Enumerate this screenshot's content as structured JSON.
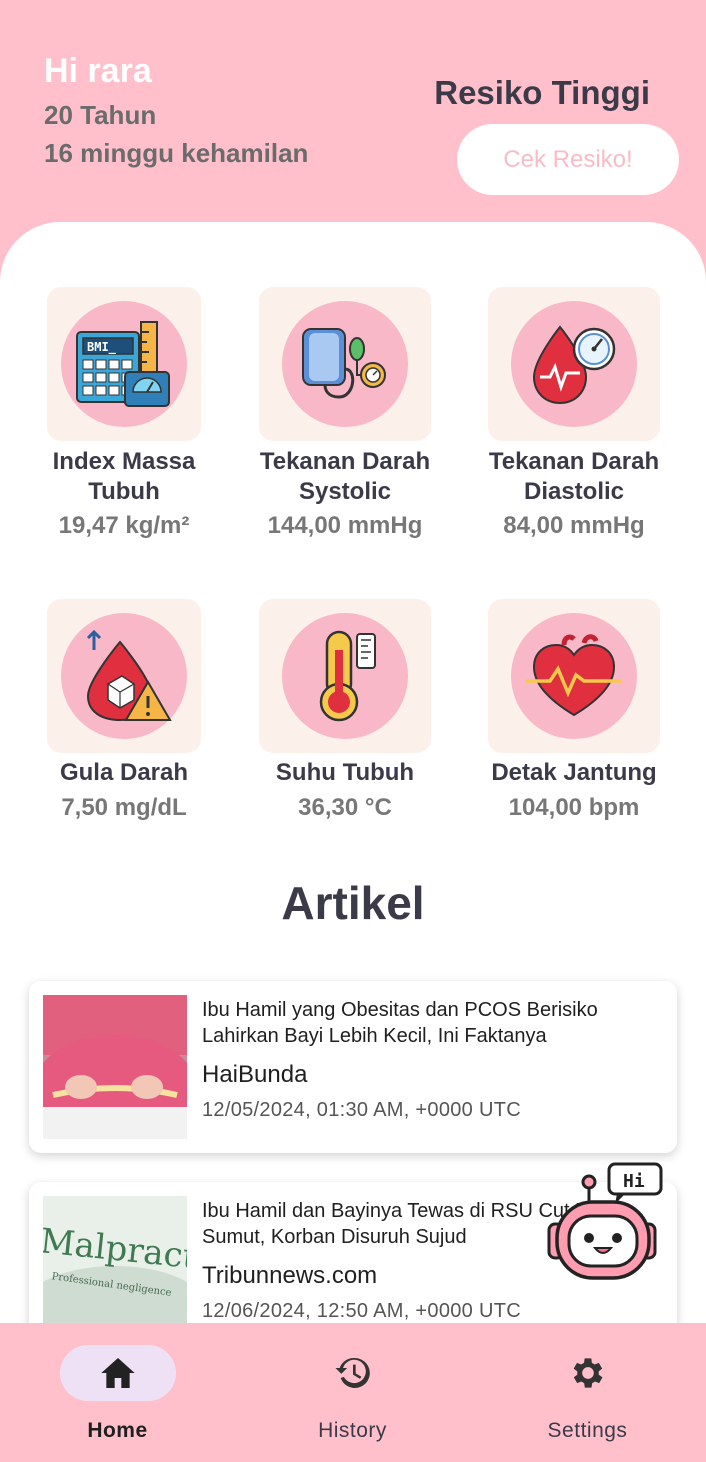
{
  "header": {
    "greeting": "Hi rara",
    "age": "20 Tahun",
    "pregnancy": "16 minggu kehamilan",
    "risk_status": "Resiko Tinggi",
    "check_button": "Cek Resiko!"
  },
  "metrics": [
    {
      "label": "Index Massa Tubuh",
      "value": "19,47 kg/m²",
      "icon": "bmi-icon"
    },
    {
      "label": "Tekanan Darah Systolic",
      "value": "144,00 mmHg",
      "icon": "blood-pressure-icon"
    },
    {
      "label": "Tekanan Darah Diastolic",
      "value": "84,00 mmHg",
      "icon": "blood-drop-gauge-icon"
    },
    {
      "label": "Gula Darah",
      "value": "7,50 mg/dL",
      "icon": "blood-sugar-icon"
    },
    {
      "label": "Suhu Tubuh",
      "value": "36,30 °C",
      "icon": "thermometer-icon"
    },
    {
      "label": "Detak Jantung",
      "value": "104,00 bpm",
      "icon": "heart-rate-icon"
    }
  ],
  "articles_section": {
    "title": "Artikel",
    "items": [
      {
        "title": "Ibu Hamil yang Obesitas dan PCOS Berisiko Lahirkan Bayi Lebih Kecil, Ini Faktanya",
        "source": "HaiBunda",
        "date": "12/05/2024, 01:30 AM, +0000 UTC"
      },
      {
        "title": "Ibu Hamil dan Bayinya Tewas di RSU Cut Binjai Sumut, Korban Disuruh Sujud",
        "source": "Tribunnews.com",
        "date": "12/06/2024, 12:50 AM, +0000 UTC",
        "image_text": "Malpractice",
        "image_subtext": "Professional negligence"
      }
    ]
  },
  "chatbot": {
    "bubble_text": "Hi"
  },
  "bottom_nav": [
    {
      "label": "Home",
      "icon": "home-icon",
      "active": true
    },
    {
      "label": "History",
      "icon": "history-icon",
      "active": false
    },
    {
      "label": "Settings",
      "icon": "gear-icon",
      "active": false
    }
  ],
  "colors": {
    "brand_pink": "#ffc0cb",
    "tile_background": "#fbf1ea",
    "icon_circle": "#f9b8c7",
    "active_nav_pill": "#efe1f5"
  }
}
